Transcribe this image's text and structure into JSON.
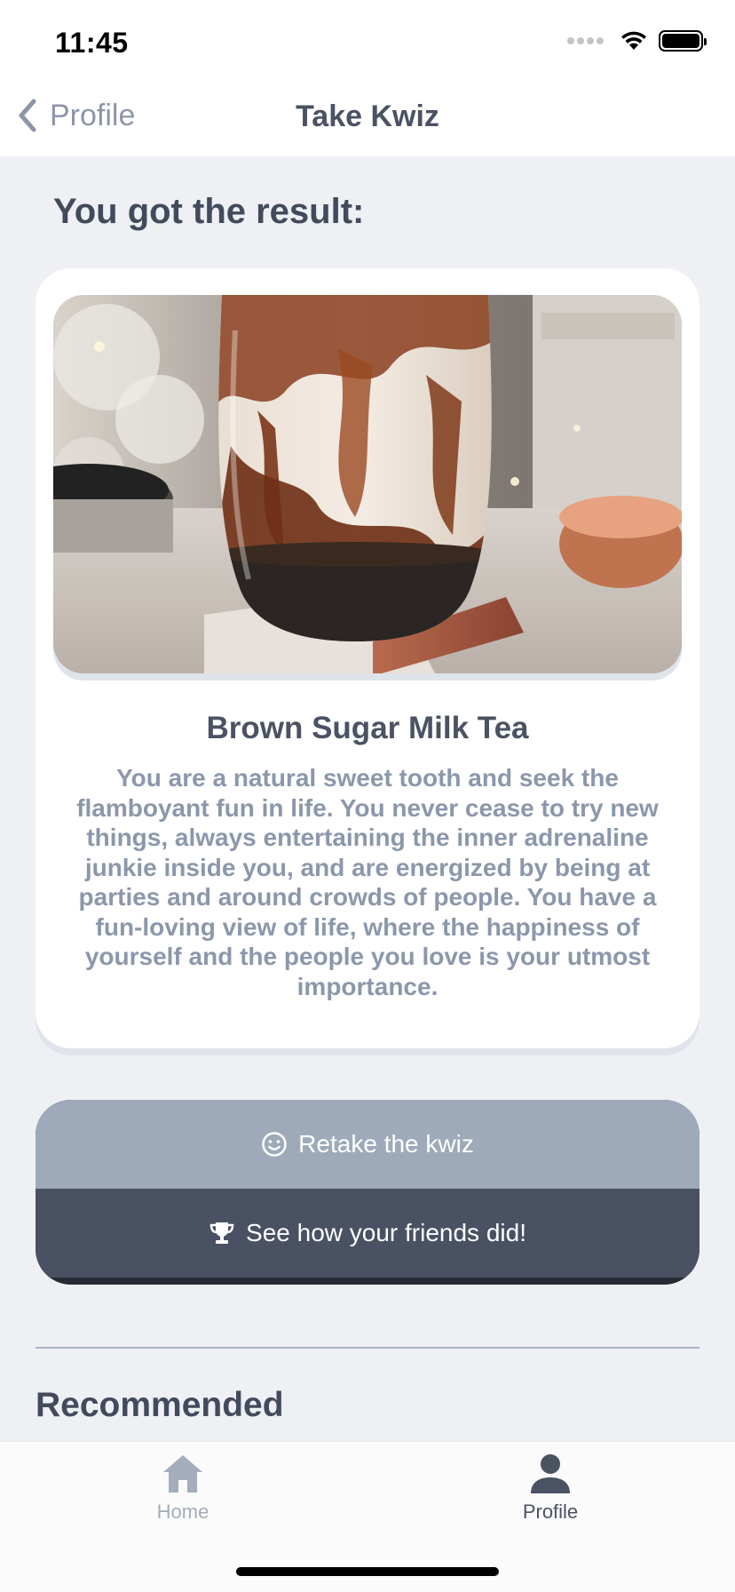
{
  "status_bar": {
    "time": "11:45"
  },
  "nav": {
    "back_label": "Profile",
    "title": "Take Kwiz"
  },
  "result": {
    "heading": "You got the result:",
    "title": "Brown Sugar Milk Tea",
    "description": "You are a natural sweet tooth and seek the flamboyant fun in life. You never cease to try new things, always entertaining the inner adrenaline junkie inside you, and are energized by being at parties and around crowds of people. You have a fun-loving view of life, where the happiness of yourself and the people you love is your utmost importance.",
    "image_icon": "brown-sugar-milk-tea-photo"
  },
  "actions": {
    "retake_label": "Retake the kwiz",
    "retake_icon": "smiley-icon",
    "friends_label": "See how your friends did!",
    "friends_icon": "trophy-icon"
  },
  "recommended": {
    "heading": "Recommended"
  },
  "tab_bar": {
    "items": [
      {
        "label": "Home",
        "icon": "home-icon",
        "active": false
      },
      {
        "label": "Profile",
        "icon": "person-icon",
        "active": true
      }
    ]
  },
  "colors": {
    "background": "#eef0f4",
    "card": "#ffffff",
    "retake_button": "#9eaaba",
    "friends_button": "#4a5163",
    "text_dark": "#4a5263",
    "text_muted": "#8c97ab"
  }
}
